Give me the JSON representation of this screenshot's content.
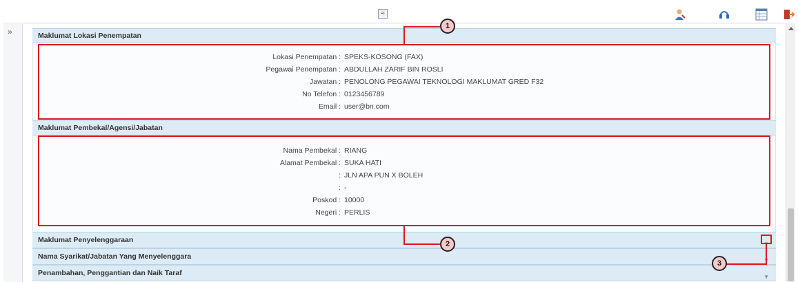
{
  "toolbar": {
    "collapse_glyph": "≈",
    "icons": [
      "collapse-up-icon",
      "user-icon",
      "helpdesk-icon",
      "grid-icon",
      "logout-icon"
    ]
  },
  "side_rail": {
    "expand_glyph": "»"
  },
  "sections": {
    "lokasi": {
      "title": "Maklumat Lokasi Penempatan",
      "rows": [
        {
          "label": "Lokasi Penempatan :",
          "value": "SPEKS-KOSONG (FAX)"
        },
        {
          "label": "Pegawai Penempatan :",
          "value": "ABDULLAH ZARIF BIN ROSLI"
        },
        {
          "label": "Jawatan :",
          "value": "PENOLONG PEGAWAI TEKNOLOGI MAKLUMAT GRED F32"
        },
        {
          "label": "No Telefon :",
          "value": "0123456789"
        },
        {
          "label": "Email :",
          "value": "user@bn.com"
        }
      ]
    },
    "pembekal": {
      "title": "Maklumat Pembekal/Agensi/Jabatan",
      "rows": [
        {
          "label": "Nama Pembekal :",
          "value": "RIANG"
        },
        {
          "label": "Alamat Pembekal :",
          "value": "SUKA HATI"
        },
        {
          "label": ":",
          "value": "JLN APA PUN X BOLEH"
        },
        {
          "label": ":",
          "value": "-"
        },
        {
          "label": "Poskod :",
          "value": "10000"
        },
        {
          "label": "Negeri :",
          "value": "PERLIS"
        }
      ]
    },
    "penyelenggaraan": {
      "title": "Maklumat Penyelenggaraan"
    },
    "syarikat": {
      "title": "Nama Syarikat/Jabatan Yang Menyelenggara"
    },
    "penambahan": {
      "title": "Penambahan, Penggantian dan Naik Taraf"
    }
  },
  "callouts": [
    "1",
    "2",
    "3"
  ],
  "colors": {
    "highlight": "#e0141e",
    "section_header": "#dcebf5"
  }
}
